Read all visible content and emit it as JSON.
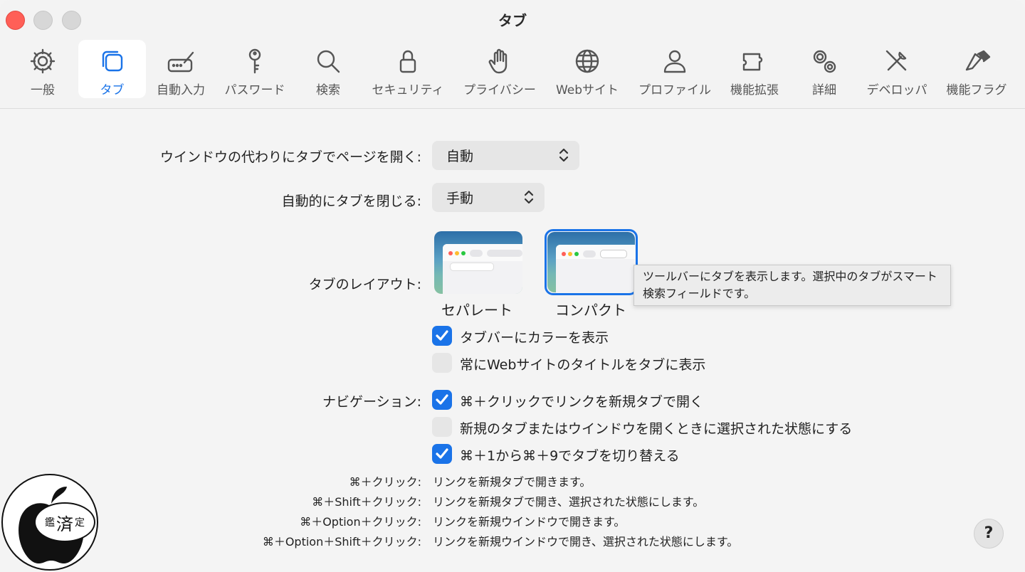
{
  "window": {
    "title": "タブ"
  },
  "toolbar": {
    "items": [
      {
        "label": "一般",
        "icon": "gear-icon"
      },
      {
        "label": "タブ",
        "icon": "tabs-icon",
        "active": true
      },
      {
        "label": "自動入力",
        "icon": "autofill-icon"
      },
      {
        "label": "パスワード",
        "icon": "key-icon"
      },
      {
        "label": "検索",
        "icon": "magnifier-icon"
      },
      {
        "label": "セキュリティ",
        "icon": "lock-icon"
      },
      {
        "label": "プライバシー",
        "icon": "hand-icon"
      },
      {
        "label": "Webサイト",
        "icon": "globe-icon"
      },
      {
        "label": "プロファイル",
        "icon": "person-icon"
      },
      {
        "label": "機能拡張",
        "icon": "puzzle-icon"
      },
      {
        "label": "詳細",
        "icon": "gears-icon"
      },
      {
        "label": "デベロッパ",
        "icon": "tools-icon"
      },
      {
        "label": "機能フラグ",
        "icon": "flags-icon"
      }
    ]
  },
  "settings": {
    "open_pages": {
      "label": "ウインドウの代わりにタブでページを開く:",
      "value": "自動"
    },
    "auto_close": {
      "label": "自動的にタブを閉じる:",
      "value": "手動"
    },
    "tab_layout": {
      "label": "タブのレイアウト:",
      "options": [
        {
          "caption": "セパレート"
        },
        {
          "caption": "コンパクト",
          "selected": true
        }
      ],
      "tooltip": "ツールバーにタブを表示します。選択中のタブがスマート検索フィールドです。"
    },
    "show_color": {
      "label": "タブバーにカラーを表示",
      "checked": true
    },
    "show_title": {
      "label": "常にWebサイトのタイトルをタブに表示",
      "checked": false
    },
    "navigation": {
      "label": "ナビゲーション:",
      "options": [
        {
          "label": "⌘＋クリックでリンクを新規タブで開く",
          "checked": true
        },
        {
          "label": "新規のタブまたはウインドウを開くときに選択された状態にする",
          "checked": false
        },
        {
          "label": "⌘＋1から⌘＋9でタブを切り替える",
          "checked": true
        }
      ]
    },
    "shortcuts": [
      {
        "key": "⌘＋クリック:",
        "desc": "リンクを新規タブで開きます。"
      },
      {
        "key": "⌘＋Shift＋クリック:",
        "desc": "リンクを新規タブで開き、選択された状態にします。"
      },
      {
        "key": "⌘＋Option＋クリック:",
        "desc": "リンクを新規ウインドウで開きます。"
      },
      {
        "key": "⌘＋Option＋Shift＋クリック:",
        "desc": "リンクを新規ウインドウで開き、選択された状態にします。"
      }
    ]
  },
  "help": {
    "label": "?"
  },
  "watermark": {
    "text": [
      "鑑",
      "済",
      "定"
    ]
  },
  "colors": {
    "accent": "#1a73e8",
    "close": "#ff5f57"
  }
}
